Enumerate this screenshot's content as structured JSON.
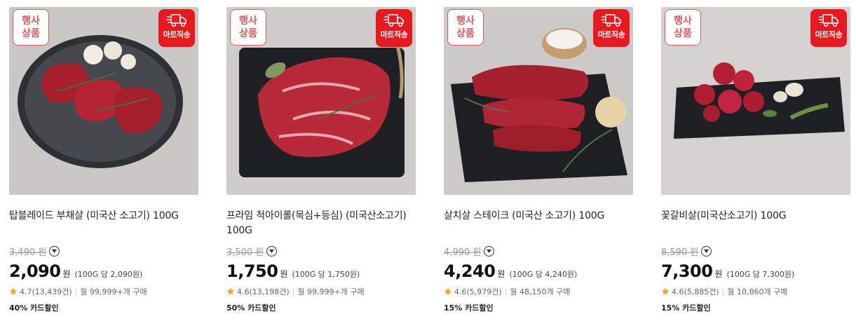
{
  "colors": {
    "badge_red": "#e8191e",
    "event_red": "#e3595e",
    "star": "#f5a623"
  },
  "products": [
    {
      "event_line1": "행사",
      "event_line2": "상품",
      "mart_label": "마트직송",
      "title": "탑블레이드 부채살 (미국산 소고기) 100G",
      "original_price": "3,490 원",
      "price": "2,090",
      "won": "원",
      "unit_price": "(100G 당 2,090원)",
      "rating": "4.7",
      "reviews": "(13,439건)",
      "monthly": "월 99,999+개 구매",
      "discount": "40% 카드할인"
    },
    {
      "event_line1": "행사",
      "event_line2": "상품",
      "mart_label": "마트직송",
      "title": "프라임 척아이롤(목심+등심) (미국산소고기) 100G",
      "original_price": "3,500 원",
      "price": "1,750",
      "won": "원",
      "unit_price": "(100G 당 1,750원)",
      "rating": "4.6",
      "reviews": "(13,198건)",
      "monthly": "월 99,999+개 구매",
      "discount": "50% 카드할인"
    },
    {
      "event_line1": "행사",
      "event_line2": "상품",
      "mart_label": "마트직송",
      "title": "살치살 스테이크 (미국산 소고기) 100G",
      "original_price": "4,990 원",
      "price": "4,240",
      "won": "원",
      "unit_price": "(100G 당 4,240원)",
      "rating": "4.6",
      "reviews": "(5,979건)",
      "monthly": "월 48,150개 구매",
      "discount": "15% 카드할인"
    },
    {
      "event_line1": "행사",
      "event_line2": "상품",
      "mart_label": "마트직송",
      "title": "꽃갈비살(미국산소고기) 100G",
      "original_price": "8,590 원",
      "price": "7,300",
      "won": "원",
      "unit_price": "(100G 당 7,300원)",
      "rating": "4.6",
      "reviews": "(5,885건)",
      "monthly": "월 10,860개 구매",
      "discount": "15% 카드할인"
    }
  ]
}
